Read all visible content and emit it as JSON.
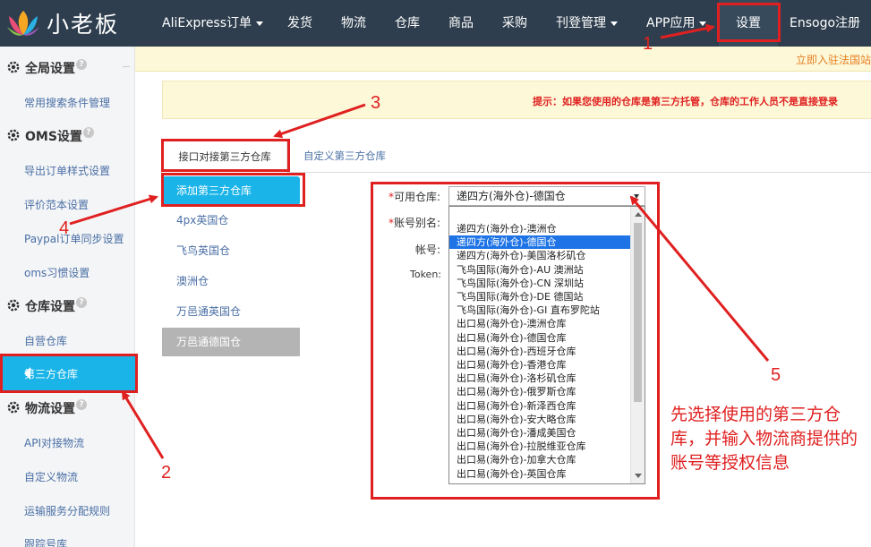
{
  "brand": {
    "name": "小老板"
  },
  "topnav": {
    "items": [
      {
        "label": "AliExpress订单",
        "dropdown": true
      },
      {
        "label": "发货"
      },
      {
        "label": "物流"
      },
      {
        "label": "仓库"
      },
      {
        "label": "商品"
      },
      {
        "label": "采购"
      },
      {
        "label": "刊登管理",
        "dropdown": true
      },
      {
        "label": "APP应用",
        "dropdown": true
      },
      {
        "label": "设置",
        "active": true
      },
      {
        "label": "Ensogo注册"
      }
    ]
  },
  "notice": {
    "text": "立即入驻法国站"
  },
  "sidebar": {
    "sections": [
      {
        "title": "全局设置",
        "items": [
          "常用搜索条件管理"
        ]
      },
      {
        "title": "OMS设置",
        "items": [
          "导出订单样式设置",
          "评价范本设置",
          "Paypal订单同步设置",
          "oms习惯设置"
        ]
      },
      {
        "title": "仓库设置",
        "items": [
          "自营仓库",
          "第三方仓库"
        ],
        "active_item": "第三方仓库"
      },
      {
        "title": "物流设置",
        "items": [
          "API对接物流",
          "自定义物流",
          "运输服务分配规则",
          "跟踪号库"
        ]
      }
    ]
  },
  "main": {
    "tip": "提示：如果您使用的仓库是第三方托管，仓库的工作人员不是直接登录",
    "tabs": [
      {
        "label": "接口对接第三方仓库",
        "active": true
      },
      {
        "label": "自定义第三方仓库"
      }
    ],
    "warehouse_list": {
      "add_label": "添加第三方仓库",
      "items": [
        "4px英国仓",
        "飞鸟英国仓",
        "澳洲仓",
        "万邑通英国仓",
        "万邑通德国仓"
      ],
      "selected": "万邑通德国仓"
    },
    "form": {
      "warehouse_label": "*可用仓库:",
      "alias_label": "*账号别名:",
      "account_label": "帐号:",
      "token_label": "Token:",
      "selected_warehouse": "递四方(海外仓)-德国仓",
      "options": [
        "递四方(海外仓)-澳洲仓",
        "递四方(海外仓)-德国仓",
        "递四方(海外仓)-美国洛杉矶仓",
        "飞鸟国际(海外仓)-AU 澳洲站",
        "飞鸟国际(海外仓)-CN 深圳站",
        "飞鸟国际(海外仓)-DE 德国站",
        "飞鸟国际(海外仓)-GI 直布罗陀站",
        "出口易(海外仓)-澳洲仓库",
        "出口易(海外仓)-德国仓库",
        "出口易(海外仓)-西班牙仓库",
        "出口易(海外仓)-香港仓库",
        "出口易(海外仓)-洛杉矶仓库",
        "出口易(海外仓)-俄罗斯仓库",
        "出口易(海外仓)-新泽西仓库",
        "出口易(海外仓)-安大略仓库",
        "出口易(海外仓)-潘成美国仓",
        "出口易(海外仓)-拉脱维亚仓库",
        "出口易(海外仓)-加拿大仓库",
        "出口易(海外仓)-英国仓库"
      ],
      "highlighted_option": "递四方(海外仓)-德国仓"
    }
  },
  "annotations": {
    "numbers": [
      "1",
      "2",
      "3",
      "4",
      "5"
    ],
    "note": "先选择使用的第三方仓库，并输入物流商提供的账号等授权信息",
    "color": "#e02020"
  },
  "colors": {
    "nav_bg": "#2e3e4e",
    "accent": "#1ab4e8",
    "highlight": "#1e74e6"
  }
}
